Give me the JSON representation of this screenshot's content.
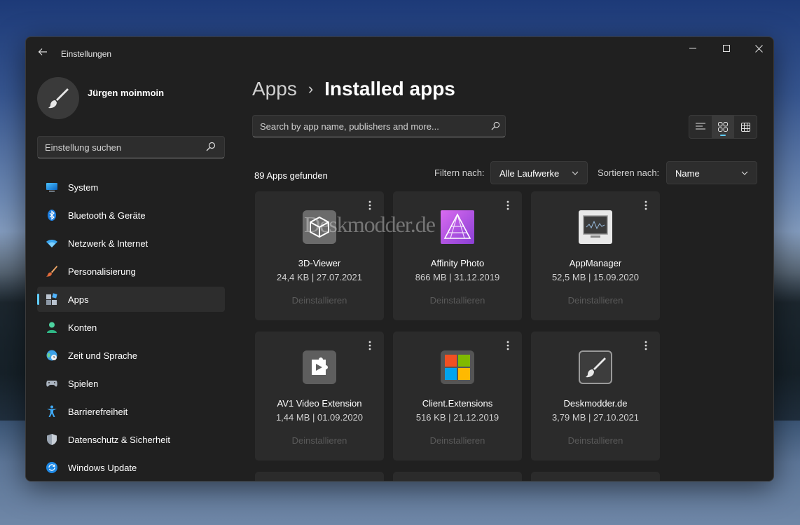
{
  "window": {
    "title": "Einstellungen"
  },
  "profile": {
    "name": "Jürgen moinmoin"
  },
  "sidebar": {
    "search_placeholder": "Einstellung suchen",
    "items": [
      {
        "label": "System",
        "icon": "system-icon"
      },
      {
        "label": "Bluetooth & Geräte",
        "icon": "bluetooth-icon"
      },
      {
        "label": "Netzwerk & Internet",
        "icon": "wifi-icon"
      },
      {
        "label": "Personalisierung",
        "icon": "brush-icon"
      },
      {
        "label": "Apps",
        "icon": "apps-icon",
        "active": true
      },
      {
        "label": "Konten",
        "icon": "account-icon"
      },
      {
        "label": "Zeit und Sprache",
        "icon": "globe-clock-icon"
      },
      {
        "label": "Spielen",
        "icon": "gamepad-icon"
      },
      {
        "label": "Barrierefreiheit",
        "icon": "accessibility-icon"
      },
      {
        "label": "Datenschutz & Sicherheit",
        "icon": "shield-icon"
      },
      {
        "label": "Windows Update",
        "icon": "update-icon"
      }
    ]
  },
  "breadcrumb": {
    "parent": "Apps",
    "separator": "›",
    "current": "Installed apps"
  },
  "main": {
    "search_placeholder": "Search by app name, publishers and more...",
    "result_count": "89 Apps gefunden",
    "filter_label": "Filtern nach:",
    "filter_value": "Alle Laufwerke",
    "sort_label": "Sortieren nach:",
    "sort_value": "Name",
    "view_modes": [
      "list-view-icon",
      "grid-view-icon",
      "tile-view-icon"
    ],
    "selected_view": "grid-view-icon"
  },
  "apps": [
    {
      "name": "3D-Viewer",
      "meta": "24,4 KB | 27.07.2021",
      "action": "Deinstallieren",
      "icon": "3d-cube-icon"
    },
    {
      "name": "Affinity Photo",
      "meta": "866 MB | 31.12.2019",
      "action": "Deinstallieren",
      "icon": "affinity-photo-icon"
    },
    {
      "name": "AppManager",
      "meta": "52,5 MB | 15.09.2020",
      "action": "Deinstallieren",
      "icon": "monitor-icon"
    },
    {
      "name": "AV1 Video Extension",
      "meta": "1,44 MB | 01.09.2020",
      "action": "Deinstallieren",
      "icon": "video-extension-icon"
    },
    {
      "name": "Client.Extensions",
      "meta": "516 KB | 21.12.2019",
      "action": "Deinstallieren",
      "icon": "microsoft-logo-icon"
    },
    {
      "name": "Deskmodder.de",
      "meta": "3,79 MB | 27.10.2021",
      "action": "Deinstallieren",
      "icon": "brush-icon"
    }
  ],
  "watermark": "Deskmodder.de"
}
